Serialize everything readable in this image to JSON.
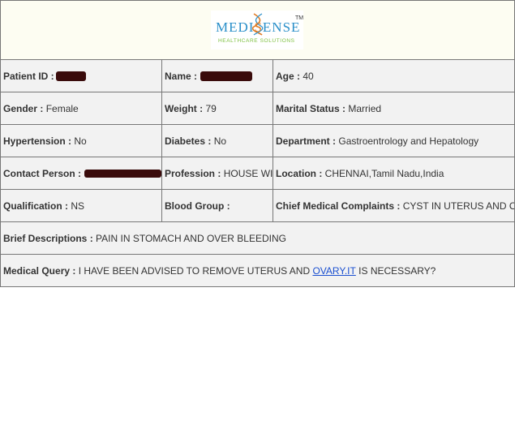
{
  "logo": {
    "word_left": "MEDI",
    "word_helix": "S",
    "word_right": "ENSE",
    "tm": "TM",
    "tagline": "HEALTHCARE SOLUTIONS"
  },
  "rows": {
    "r1": {
      "patient_id_label": "Patient ID :",
      "name_label": "Name :",
      "age_label": "Age :",
      "age_value": "40"
    },
    "r2": {
      "gender_label": "Gender :",
      "gender_value": "Female",
      "weight_label": "Weight :",
      "weight_value": "79",
      "marital_label": "Marital Status :",
      "marital_value": "Married"
    },
    "r3": {
      "hypertension_label": "Hypertension :",
      "hypertension_value": "No",
      "diabetes_label": "Diabetes :",
      "diabetes_value": "No",
      "department_label": "Department :",
      "department_value": "Gastroentrology and Hepatology"
    },
    "r4": {
      "contact_label": "Contact Person :",
      "profession_label": "Profession :",
      "profession_value": "HOUSE WIFE",
      "location_label": "Location :",
      "location_value": "CHENNAI,Tamil Nadu,India"
    },
    "r5": {
      "qualification_label": "Qualification :",
      "qualification_value": "NS",
      "blood_group_label": "Blood Group :",
      "complaints_label": "Chief Medical Complaints :",
      "complaints_value": "CYST IN UTERUS AND OVARY"
    },
    "r6": {
      "brief_label": "Brief Descriptions :",
      "brief_value": "PAIN IN STOMACH AND OVER BLEEDING"
    },
    "r7": {
      "query_label": "Medical Query :",
      "query_before": "I HAVE BEEN ADVISED TO REMOVE UTERUS AND",
      "query_link": "OVARY.IT",
      "query_after": "IS NECESSARY?"
    }
  },
  "colors": {
    "brand_blue": "#2a8fc9",
    "brand_orange": "#e07b22",
    "tagline_green": "#7bbf3c",
    "redaction": "#3a0b0b",
    "link": "#1a4fd0"
  }
}
